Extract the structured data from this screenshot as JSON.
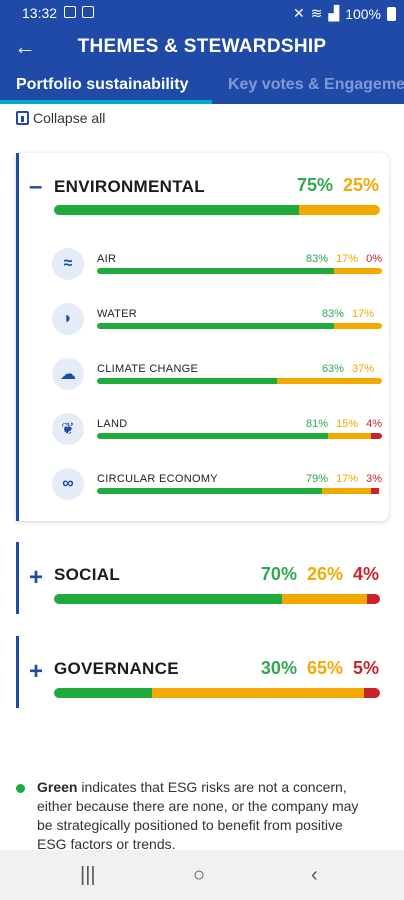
{
  "status_bar": {
    "time": "13:32",
    "battery": "100%"
  },
  "app_bar": {
    "title": "THEMES & STEWARDSHIP"
  },
  "tabs": [
    {
      "label": "Portfolio sustainability",
      "active": true
    },
    {
      "label": "Key votes & Engagement",
      "active": false
    }
  ],
  "collapse_label": "Collapse all",
  "categories": [
    {
      "label": "ENVIRONMENTAL",
      "toggle": "–",
      "expanded": true,
      "green": "75%",
      "orange": "25%",
      "red": "",
      "green_value": 75,
      "orange_value": 25,
      "red_value": 0,
      "items": [
        {
          "label": "AIR",
          "icon": "wind-icon",
          "green": "83%",
          "orange": "17%",
          "red": "0%",
          "g": 83,
          "o": 17,
          "r": 0
        },
        {
          "label": "WATER",
          "icon": "dolphin-icon",
          "green": "83%",
          "orange": "17%",
          "red": "",
          "g": 83,
          "o": 17,
          "r": 0
        },
        {
          "label": "CLIMATE CHANGE",
          "icon": "cloud-rain-icon",
          "green": "63%",
          "orange": "37%",
          "red": "",
          "g": 63,
          "o": 37,
          "r": 0
        },
        {
          "label": "LAND",
          "icon": "leaf-icon",
          "green": "81%",
          "orange": "15%",
          "red": "4%",
          "g": 81,
          "o": 15,
          "r": 4
        },
        {
          "label": "CIRCULAR ECONOMY",
          "icon": "infinity-icon",
          "green": "79%",
          "orange": "17%",
          "red": "3%",
          "g": 79,
          "o": 17,
          "r": 3
        }
      ]
    },
    {
      "label": "SOCIAL",
      "toggle": "+",
      "expanded": false,
      "green": "70%",
      "orange": "26%",
      "red": "4%",
      "green_value": 70,
      "orange_value": 26,
      "red_value": 4
    },
    {
      "label": "GOVERNANCE",
      "toggle": "+",
      "expanded": false,
      "green": "30%",
      "orange": "65%",
      "red": "5%",
      "green_value": 30,
      "orange_value": 65,
      "red_value": 5
    }
  ],
  "legend": {
    "green_term": "Green",
    "green_text": " indicates that ESG risks are not a concern, either because there are none, or the company may be strategically positioned to benefit from positive ESG factors or trends."
  },
  "colors": {
    "brand": "#1f4aa8",
    "green": "#1faa3c",
    "orange": "#f2a900",
    "red": "#c9232c"
  }
}
